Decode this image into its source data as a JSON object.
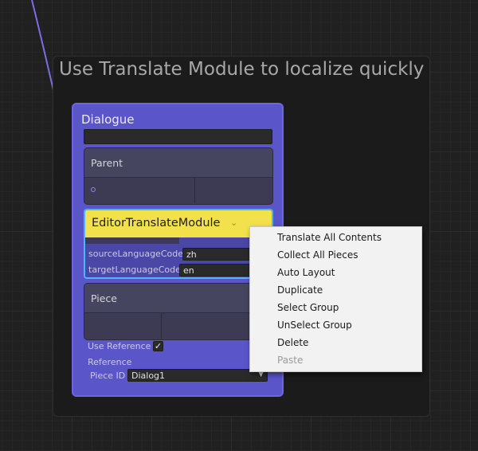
{
  "group": {
    "title": "Use Translate Module to localize quickly"
  },
  "node": {
    "title": "Dialogue",
    "parent_port": {
      "label": "Parent"
    },
    "module": {
      "title": "EditorTranslateModule",
      "source_label": "sourceLanguageCode",
      "source_value": "zh",
      "target_label": "targetLanguageCode",
      "target_value": "en"
    },
    "piece_port": {
      "label": "Piece"
    },
    "use_reference": {
      "label": "Use Reference",
      "checked_glyph": "✓"
    },
    "reference_label": "Reference",
    "piece_id": {
      "label": "Piece ID",
      "value": "Dialog1",
      "arrow": "▼"
    }
  },
  "context_menu": {
    "items": [
      {
        "label": "Translate All Contents",
        "enabled": true
      },
      {
        "label": "Collect All Pieces",
        "enabled": true
      },
      {
        "label": "Auto Layout",
        "enabled": true
      },
      {
        "label": "Duplicate",
        "enabled": true
      },
      {
        "label": "Select Group",
        "enabled": true
      },
      {
        "label": "UnSelect Group",
        "enabled": true
      },
      {
        "label": "Delete",
        "enabled": true
      },
      {
        "label": "Paste",
        "enabled": false
      }
    ]
  },
  "colors": {
    "node_bg": "#5a55c9",
    "module_header": "#f2e14a",
    "selection_outline": "#4fb4ff",
    "edge": "#7a6fe0"
  }
}
